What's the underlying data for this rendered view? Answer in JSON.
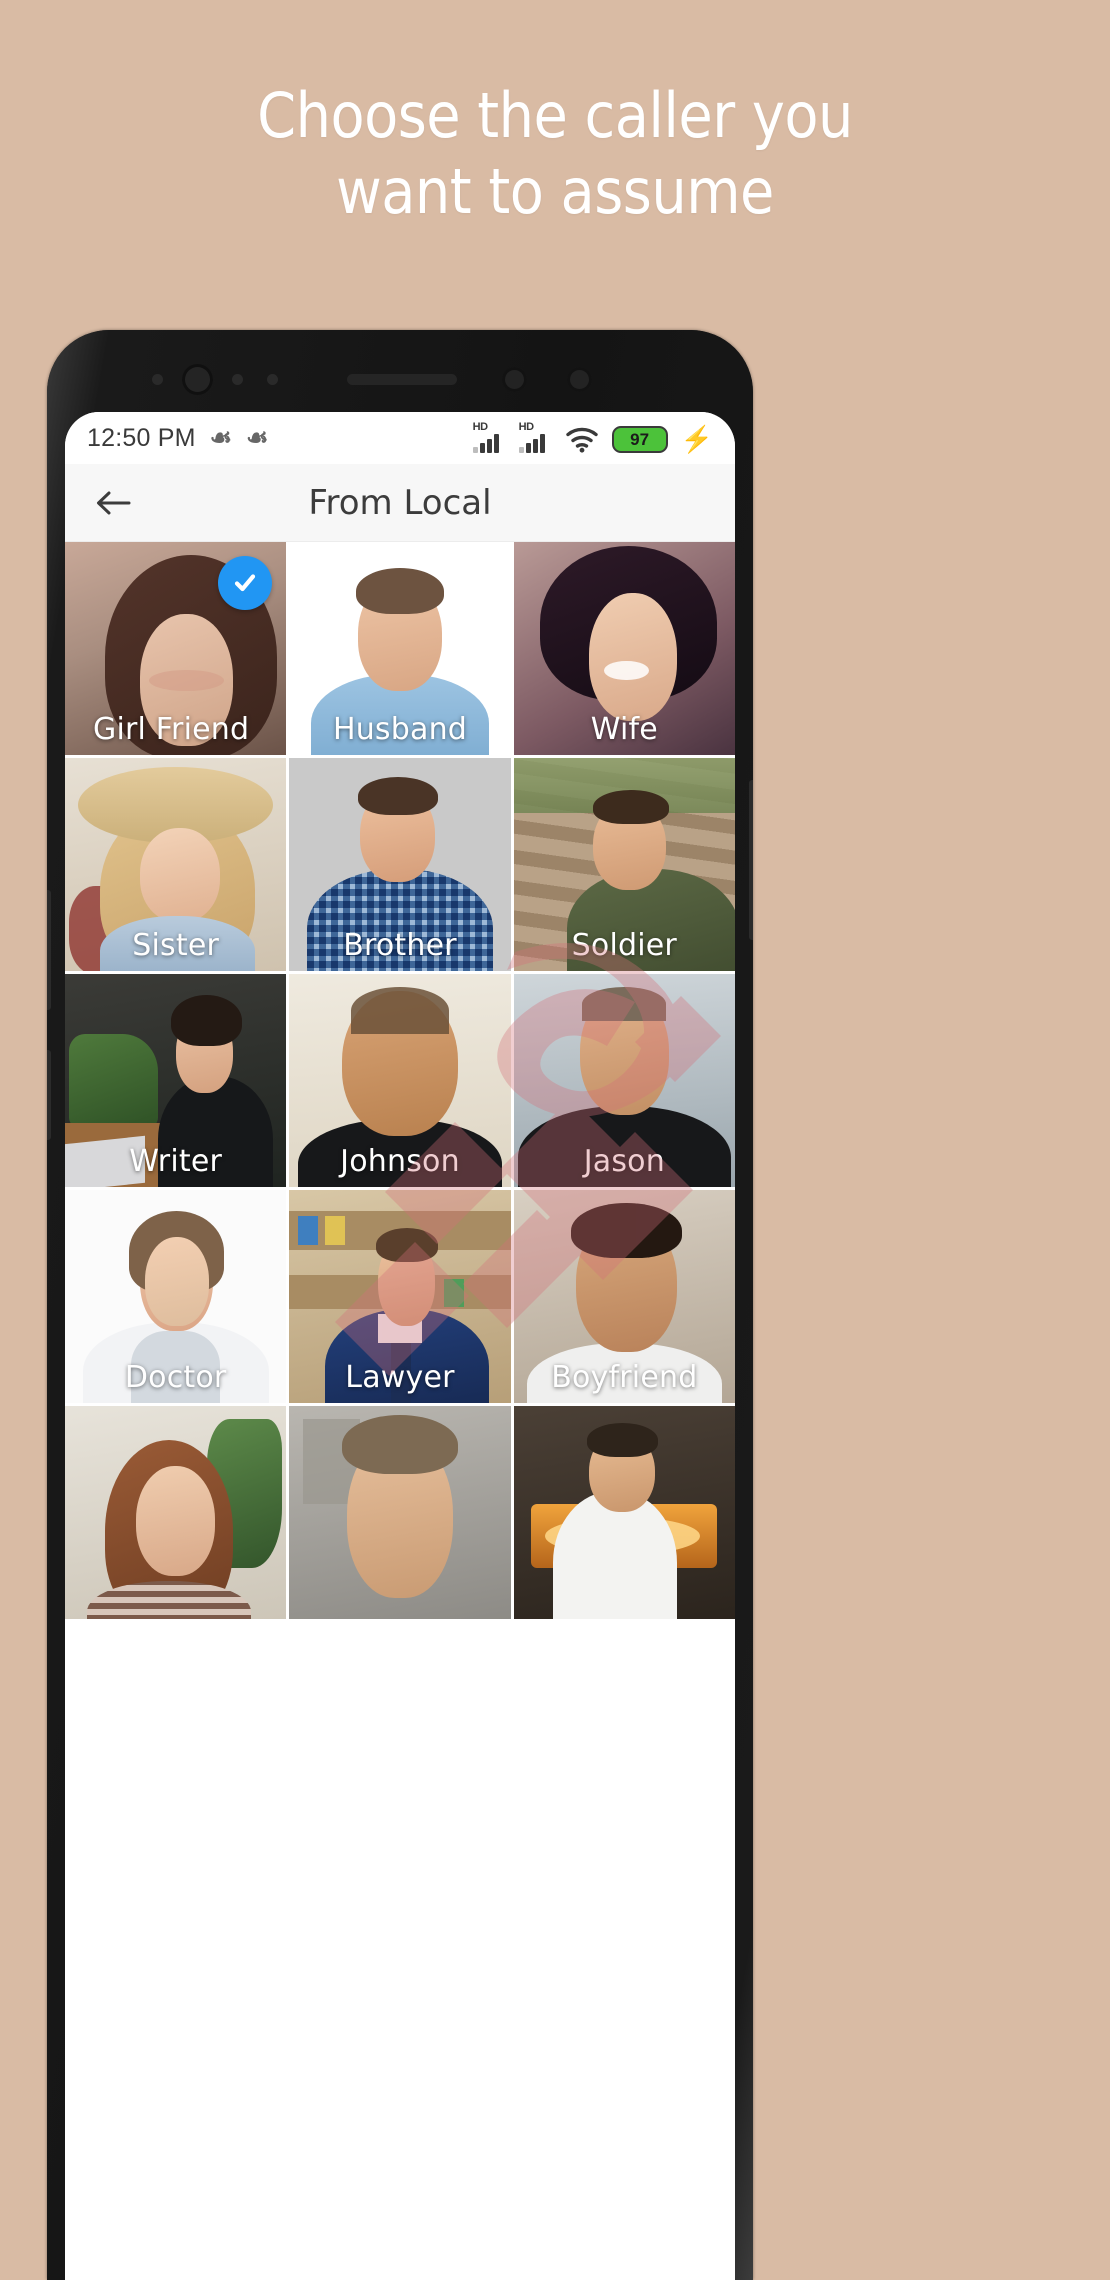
{
  "promo": {
    "headline_line1": "Choose the caller you",
    "headline_line2": "want to assume",
    "background_color": "#d9bba4",
    "text_color": "#ffffff"
  },
  "device": {
    "frame_color": "#1c1c1c",
    "screen_background": "#ffffff"
  },
  "status_bar": {
    "time": "12:50 PM",
    "notification_icons": [
      "p-icon",
      "p-icon"
    ],
    "signal_1_label": "HD",
    "signal_2_label": "HD",
    "wifi_icon": "wifi-icon",
    "battery_percent": "97",
    "battery_color": "#4cc23a",
    "charging_icon": "lightning-bolt-icon"
  },
  "app_bar": {
    "back_icon": "back-arrow-icon",
    "title": "From Local"
  },
  "selection": {
    "selected_index": 0,
    "check_icon": "check-icon",
    "check_color": "#2196f3"
  },
  "grid": {
    "columns": 3,
    "items": [
      {
        "label": "Girl Friend",
        "selected": true,
        "align": "left"
      },
      {
        "label": "Husband",
        "selected": false,
        "align": "center"
      },
      {
        "label": "Wife",
        "selected": false,
        "align": "center"
      },
      {
        "label": "Sister",
        "selected": false,
        "align": "center"
      },
      {
        "label": "Brother",
        "selected": false,
        "align": "center"
      },
      {
        "label": "Soldier",
        "selected": false,
        "align": "center"
      },
      {
        "label": "Writer",
        "selected": false,
        "align": "center"
      },
      {
        "label": "Johnson",
        "selected": false,
        "align": "center"
      },
      {
        "label": "Jason",
        "selected": false,
        "align": "center"
      },
      {
        "label": "Doctor",
        "selected": false,
        "align": "center"
      },
      {
        "label": "Lawyer",
        "selected": false,
        "align": "center"
      },
      {
        "label": "Boyfriend",
        "selected": false,
        "align": "center"
      },
      {
        "label": "",
        "selected": false,
        "align": "center"
      },
      {
        "label": "",
        "selected": false,
        "align": "center"
      },
      {
        "label": "",
        "selected": false,
        "align": "center"
      }
    ]
  },
  "watermark": {
    "color": "#d4707a",
    "note": "diagonal script overlay"
  }
}
